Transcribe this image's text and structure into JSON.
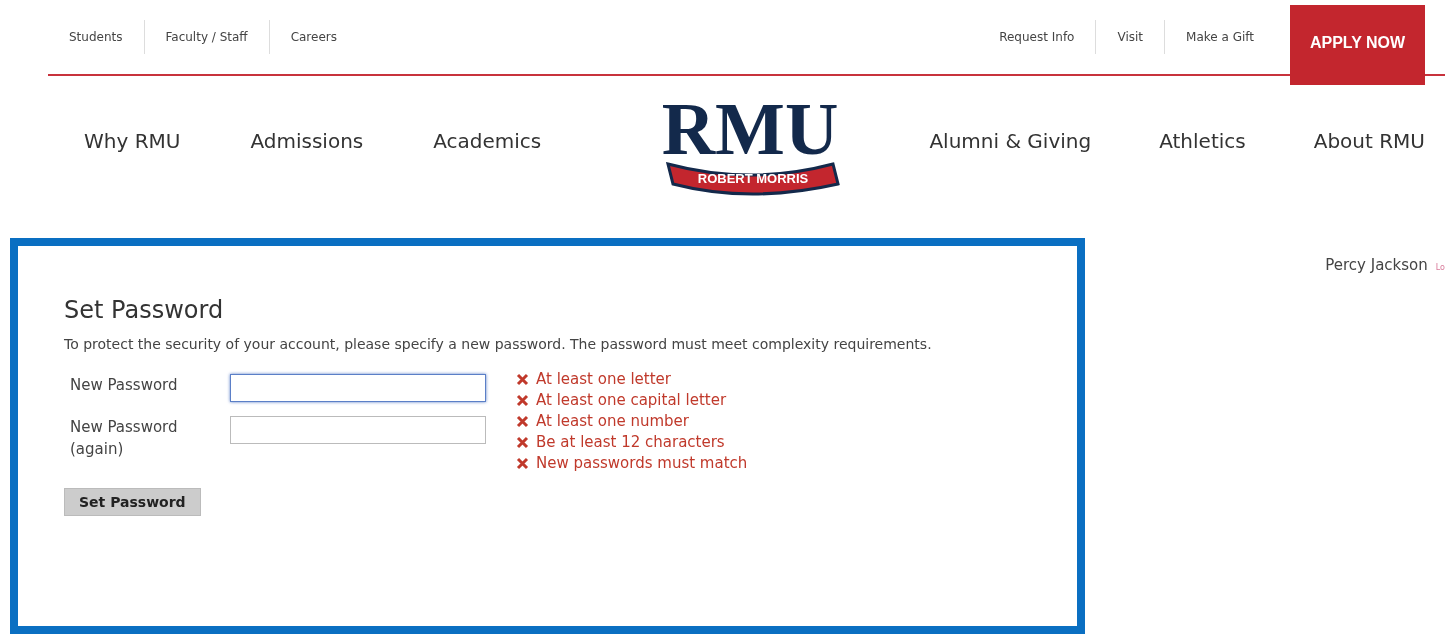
{
  "utility_links_left": [
    "Students",
    "Faculty / Staff",
    "Careers"
  ],
  "utility_links_right": [
    "Request Info",
    "Visit",
    "Make a Gift"
  ],
  "apply_button": "APPLY NOW",
  "nav_left": [
    "Why RMU",
    "Admissions",
    "Academics"
  ],
  "logo": {
    "wordmark": "RMU",
    "banner": "ROBERT MORRIS"
  },
  "nav_right": [
    "Alumni & Giving",
    "Athletics",
    "About RMU"
  ],
  "user": {
    "name": "Percy Jackson",
    "link": "Lo"
  },
  "form": {
    "title": "Set Password",
    "description": "To protect the security of your account, please specify a new password. The password must meet complexity requirements.",
    "fields": [
      {
        "label": "New Password",
        "focused": true
      },
      {
        "label": "New Password (again)",
        "focused": false
      }
    ],
    "requirements": [
      {
        "text": "At least one letter",
        "met": false
      },
      {
        "text": "At least one capital letter",
        "met": false
      },
      {
        "text": "At least one number",
        "met": false
      },
      {
        "text": "Be at least 12 characters",
        "met": false
      },
      {
        "text": "New passwords must match",
        "met": false
      }
    ],
    "submit": "Set Password"
  }
}
